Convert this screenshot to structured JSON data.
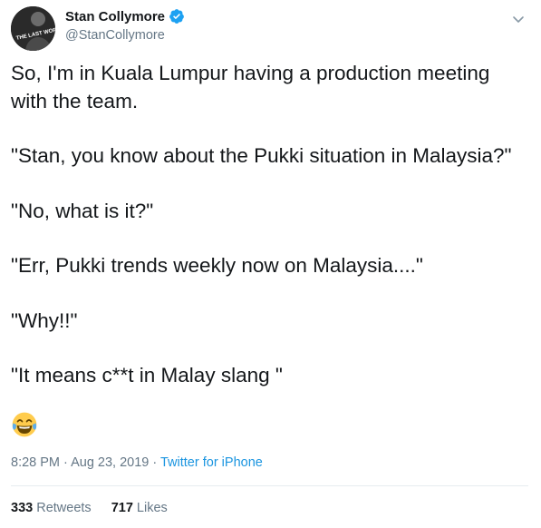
{
  "author": {
    "display_name": "Stan Collymore",
    "handle": "@StanCollymore",
    "avatar_text": "THE LAST WORD WITH"
  },
  "tweet": {
    "paragraphs": [
      "So, I'm in Kuala Lumpur having a production meeting with the team.",
      "\"Stan, you know about the Pukki situation in Malaysia?\"",
      "\"No, what is it?\"",
      "\"Err, Pukki trends weekly now on Malaysia....\"",
      "\"Why!!\"",
      "\"It means c**t in Malay slang \""
    ],
    "emoji": "tears-of-joy-emoji"
  },
  "meta": {
    "time": "8:28 PM",
    "separator": " · ",
    "date": "Aug 23, 2019",
    "source": "Twitter for iPhone"
  },
  "stats": {
    "retweets_count": "333",
    "retweets_label": "Retweets",
    "likes_count": "717",
    "likes_label": "Likes"
  },
  "colors": {
    "text": "#14171a",
    "secondary": "#657786",
    "link": "#1b95e0",
    "verified": "#1da1f2"
  }
}
